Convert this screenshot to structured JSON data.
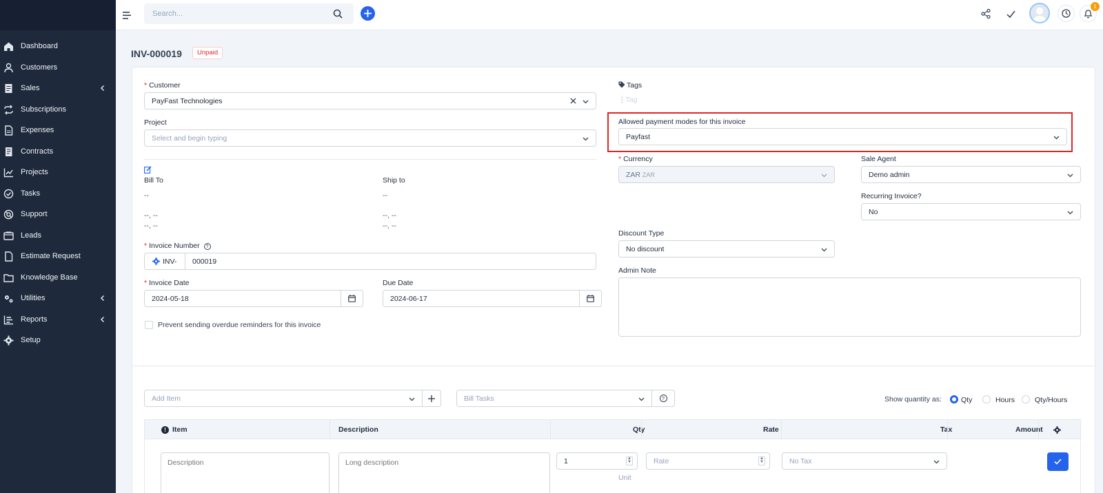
{
  "sidebar": {
    "items": [
      {
        "label": "Dashboard",
        "icon": "home-icon",
        "submenu": false
      },
      {
        "label": "Customers",
        "icon": "user-icon",
        "submenu": false
      },
      {
        "label": "Sales",
        "icon": "receipt-icon",
        "submenu": true
      },
      {
        "label": "Subscriptions",
        "icon": "repeat-icon",
        "submenu": false
      },
      {
        "label": "Expenses",
        "icon": "file-icon",
        "submenu": false
      },
      {
        "label": "Contracts",
        "icon": "contract-icon",
        "submenu": false
      },
      {
        "label": "Projects",
        "icon": "chart-icon",
        "submenu": false
      },
      {
        "label": "Tasks",
        "icon": "check-circle-icon",
        "submenu": false
      },
      {
        "label": "Support",
        "icon": "lifebuoy-icon",
        "submenu": false
      },
      {
        "label": "Leads",
        "icon": "leads-icon",
        "submenu": false
      },
      {
        "label": "Estimate Request",
        "icon": "document-icon",
        "submenu": false
      },
      {
        "label": "Knowledge Base",
        "icon": "folder-icon",
        "submenu": false
      },
      {
        "label": "Utilities",
        "icon": "cogs-icon",
        "submenu": true
      },
      {
        "label": "Reports",
        "icon": "bar-chart-icon",
        "submenu": true
      },
      {
        "label": "Setup",
        "icon": "gear-icon",
        "submenu": false
      }
    ]
  },
  "topbar": {
    "search_placeholder": "Search...",
    "notification_count": "1"
  },
  "invoice": {
    "title": "INV-000019",
    "status": "Unpaid"
  },
  "form": {
    "customer_label": "Customer",
    "customer_value": "PayFast Technologies",
    "project_label": "Project",
    "project_placeholder": "Select and begin typing",
    "bill_to_label": "Bill To",
    "ship_to_label": "Ship to",
    "bill_to_lines": [
      "--",
      "--, --",
      "--, --"
    ],
    "ship_to_lines": [
      "--",
      "--, --",
      "--, --"
    ],
    "invoice_number_label": "Invoice Number",
    "invoice_prefix": "INV-",
    "invoice_number_value": "000019",
    "invoice_date_label": "Invoice Date",
    "invoice_date_value": "2024-05-18",
    "due_date_label": "Due Date",
    "due_date_value": "2024-06-17",
    "prevent_reminders_label": "Prevent sending overdue reminders for this invoice",
    "tags_label": "Tags",
    "tag_placeholder": "Tag",
    "payment_modes_label": "Allowed payment modes for this invoice",
    "payment_modes_value": "Payfast",
    "currency_label": "Currency",
    "currency_value": "ZAR",
    "currency_sub": "ZAR",
    "sale_agent_label": "Sale Agent",
    "sale_agent_value": "Demo admin",
    "recurring_label": "Recurring Invoice?",
    "recurring_value": "No",
    "discount_type_label": "Discount Type",
    "discount_type_value": "No discount",
    "admin_note_label": "Admin Note"
  },
  "items": {
    "add_item_placeholder": "Add Item",
    "bill_tasks_placeholder": "Bill Tasks",
    "show_quantity_label": "Show quantity as:",
    "quantity_options": [
      "Qty",
      "Hours",
      "Qty/Hours"
    ],
    "quantity_selected": "Qty",
    "columns": [
      "Item",
      "Description",
      "Qty",
      "Rate",
      "Tax",
      "Amount"
    ],
    "row": {
      "description_placeholder": "Description",
      "long_description_placeholder": "Long description",
      "qty_value": "1",
      "rate_placeholder": "Rate",
      "unit_placeholder": "Unit",
      "tax_value": "No Tax"
    }
  },
  "colors": {
    "sidebar_bg": "#1e293b",
    "accent": "#2563eb",
    "highlight": "#dc2626"
  }
}
